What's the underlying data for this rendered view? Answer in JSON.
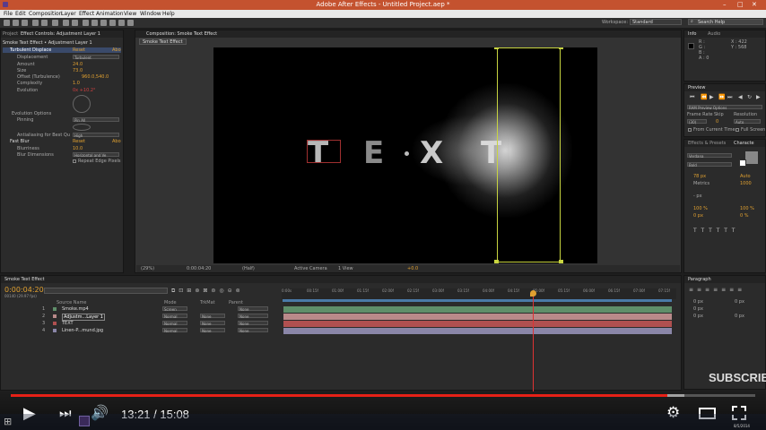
{
  "titlebar": {
    "title": "Adobe After Effects - Untitled Project.aep *"
  },
  "menubar": {
    "items": [
      "File",
      "Edit",
      "Composition",
      "Layer",
      "Effect",
      "Animation",
      "View",
      "Window",
      "Help"
    ]
  },
  "toolbar": {
    "workspace_label": "Workspace:",
    "workspace_value": "Standard",
    "search_placeholder": "Search Help"
  },
  "project_panel": {
    "tab_project": "Project",
    "tab_effect_controls": "Effect Controls: Adjustment Layer 1",
    "header": "Smoke Text Effect • Adjustment Layer 1",
    "effects": [
      {
        "name": "Turbulent Displace",
        "reset": "Reset",
        "about": "Abo"
      },
      {
        "name": "Displacement",
        "value": "Turbulent"
      },
      {
        "name": "Amount",
        "value": "24.0"
      },
      {
        "name": "Size",
        "value": "73.0"
      },
      {
        "name": "Offset (Turbulence)",
        "value": "960.0,540.0"
      },
      {
        "name": "Complexity",
        "value": "1.0"
      },
      {
        "name": "Evolution",
        "value": "0x +10.2°"
      },
      {
        "name": "Evolution Options",
        "value": ""
      },
      {
        "name": "Pinning",
        "value": "Pin All"
      },
      {
        "name": "Antialiasing for Best Qu",
        "value": "High"
      },
      {
        "name": "Fast Blur",
        "reset": "Reset",
        "about": "Abo"
      },
      {
        "name": "Blurriness",
        "value": "10.0"
      },
      {
        "name": "Blur Dimensions",
        "value": "Horizontal and Ve"
      },
      {
        "name": "Repeat Edge Pixels",
        "value": ""
      }
    ]
  },
  "composition_panel": {
    "tab": "Composition: Smoke Text Effect",
    "subtab": "Smoke Text Effect",
    "canvas_text": "TEXT",
    "footer": {
      "zoom": "(29%)",
      "timecode": "0:00:04:20",
      "resolution": "(Half)",
      "camera": "Active Camera",
      "view": "1 View",
      "offset": "+0.0"
    }
  },
  "info_panel": {
    "tab_info": "Info",
    "tab_audio": "Audio",
    "r": "R :",
    "g": "G :",
    "b": "B :",
    "a": "A : 0",
    "x": "X : 422",
    "y": "Y : 568"
  },
  "preview_panel": {
    "tab": "Preview",
    "ram_options": "RAM Preview Options",
    "frame_rate_label": "Frame Rate",
    "skip_label": "Skip",
    "resolution_label": "Resolution",
    "frame_rate": "(30)",
    "skip": "0",
    "resolution": "Auto",
    "from_current": "From Current Time",
    "full_screen": "Full Screen"
  },
  "character_panel": {
    "tab_effects": "Effects & Presets",
    "tab_character": "Characte",
    "font": "Verdana",
    "style": "Bold",
    "size": "78 px",
    "leading": "Auto",
    "kerning": "Metrics",
    "tracking": "1000",
    "stroke": "- px",
    "vscale": "100 %",
    "hscale": "100 %",
    "baseline": "0 px",
    "tsume": "0 %"
  },
  "paragraph_panel": {
    "tab": "Paragraph",
    "indent1": "0 px",
    "indent2": "0 px",
    "indent3": "0 px",
    "space1": "0 px",
    "space2": "0 px"
  },
  "timeline": {
    "tab": "Smoke Text Effect",
    "timecode": "0:00:04:20",
    "timecode_sub": "00140 (29.97 fps)",
    "columns": {
      "source_name": "Source Name",
      "mode": "Mode",
      "trkmat": "TrkMat",
      "parent": "Parent"
    },
    "ruler": [
      "0:00s",
      "00:15f",
      "01:00f",
      "01:15f",
      "02:00f",
      "02:15f",
      "03:00f",
      "03:15f",
      "04:00f",
      "04:15f",
      "05:00f",
      "05:15f",
      "06:00f",
      "06:15f",
      "07:00f",
      "07:15f"
    ],
    "layers": [
      {
        "num": "1",
        "name": "Smoke.mp4",
        "mode": "Screen",
        "trkmat": "",
        "parent": "None",
        "color": "#5f8f6a"
      },
      {
        "num": "2",
        "name": "Adjustm...Layer 1",
        "mode": "Normal",
        "trkmat": "None",
        "parent": "None",
        "color": "#b98a8a"
      },
      {
        "num": "3",
        "name": "TEXT",
        "mode": "Normal",
        "trkmat": "None",
        "parent": "None",
        "color": "#b05050"
      },
      {
        "num": "4",
        "name": "Linen-P...mund.jpg",
        "mode": "Normal",
        "trkmat": "None",
        "parent": "None",
        "color": "#8a86a8"
      }
    ]
  },
  "video_player": {
    "time": "13:21 / 15:08",
    "progress_fraction": 0.882,
    "buffered_fraction": 0.905,
    "subscribe": "SUBSCRIBE"
  },
  "taskbar": {
    "clock_time": "",
    "clock_date": "8/5/2014"
  },
  "colors": {
    "titlebar": "#c4522f",
    "progress": "#e62117",
    "accent": "#e0a030",
    "bounding_box": "#c8d440"
  }
}
